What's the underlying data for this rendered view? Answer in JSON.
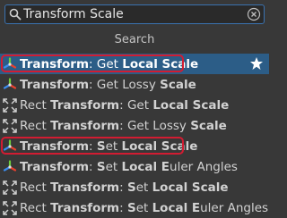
{
  "search": {
    "value": "Transform Scale",
    "placeholder": ""
  },
  "section_header": "Search",
  "colors": {
    "selected_row": "#2c5d87",
    "highlight_box": "#d21c32",
    "accent": "#3a72b0"
  },
  "results": [
    {
      "icon": "transform-icon",
      "parts": [
        {
          "t": "Transform",
          "b": true
        },
        {
          "t": ": Get ",
          "b": false
        },
        {
          "t": "Local Scale",
          "b": true
        }
      ],
      "selected": true,
      "boxed": true,
      "favorite": true
    },
    {
      "icon": "transform-icon",
      "parts": [
        {
          "t": "Transform",
          "b": true
        },
        {
          "t": ": Get Lossy ",
          "b": false
        },
        {
          "t": "Scale",
          "b": true
        }
      ],
      "selected": false,
      "boxed": false,
      "favorite": false
    },
    {
      "icon": "rect-transform-icon",
      "parts": [
        {
          "t": "Rect ",
          "b": false
        },
        {
          "t": "Transform",
          "b": true
        },
        {
          "t": ": Get ",
          "b": false
        },
        {
          "t": "Local Scale",
          "b": true
        }
      ],
      "selected": false,
      "boxed": false,
      "favorite": false
    },
    {
      "icon": "rect-transform-icon",
      "parts": [
        {
          "t": "Rect ",
          "b": false
        },
        {
          "t": "Transform",
          "b": true
        },
        {
          "t": ": Get Lossy ",
          "b": false
        },
        {
          "t": "Scale",
          "b": true
        }
      ],
      "selected": false,
      "boxed": false,
      "favorite": false
    },
    {
      "icon": "transform-icon",
      "parts": [
        {
          "t": "Transform",
          "b": true
        },
        {
          "t": ": ",
          "b": false
        },
        {
          "t": "S",
          "b": true
        },
        {
          "t": "et ",
          "b": false
        },
        {
          "t": "Local Scale",
          "b": true
        }
      ],
      "selected": false,
      "boxed": true,
      "favorite": false
    },
    {
      "icon": "transform-icon",
      "parts": [
        {
          "t": "Transform",
          "b": true
        },
        {
          "t": ": ",
          "b": false
        },
        {
          "t": "S",
          "b": true
        },
        {
          "t": "et ",
          "b": false
        },
        {
          "t": "Local E",
          "b": true
        },
        {
          "t": "uler Angles",
          "b": false
        }
      ],
      "selected": false,
      "boxed": false,
      "favorite": false
    },
    {
      "icon": "rect-transform-icon",
      "parts": [
        {
          "t": "Rect ",
          "b": false
        },
        {
          "t": "Transform",
          "b": true
        },
        {
          "t": ": ",
          "b": false
        },
        {
          "t": "S",
          "b": true
        },
        {
          "t": "et ",
          "b": false
        },
        {
          "t": "Local Scale",
          "b": true
        }
      ],
      "selected": false,
      "boxed": false,
      "favorite": false
    },
    {
      "icon": "rect-transform-icon",
      "parts": [
        {
          "t": "Rect ",
          "b": false
        },
        {
          "t": "Transform",
          "b": true
        },
        {
          "t": ": ",
          "b": false
        },
        {
          "t": "S",
          "b": true
        },
        {
          "t": "et ",
          "b": false
        },
        {
          "t": "Local E",
          "b": true
        },
        {
          "t": "uler Angles",
          "b": false
        }
      ],
      "selected": false,
      "boxed": false,
      "favorite": false
    }
  ]
}
